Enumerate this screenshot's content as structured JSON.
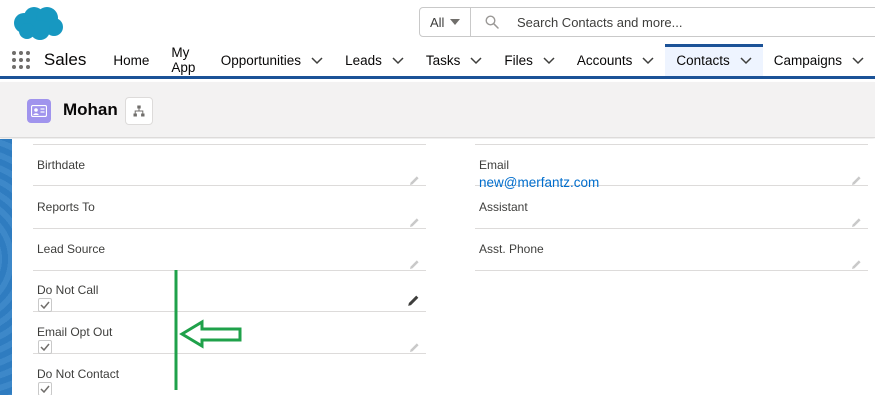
{
  "header": {
    "search": {
      "scope_label": "All",
      "placeholder": "Search Contacts and more..."
    }
  },
  "nav": {
    "app_name": "Sales",
    "items": [
      {
        "label": "Home",
        "has_menu": false,
        "active": false
      },
      {
        "label": "My App",
        "has_menu": false,
        "active": false
      },
      {
        "label": "Opportunities",
        "has_menu": true,
        "active": false
      },
      {
        "label": "Leads",
        "has_menu": true,
        "active": false
      },
      {
        "label": "Tasks",
        "has_menu": true,
        "active": false
      },
      {
        "label": "Files",
        "has_menu": true,
        "active": false
      },
      {
        "label": "Accounts",
        "has_menu": true,
        "active": false
      },
      {
        "label": "Contacts",
        "has_menu": true,
        "active": true
      },
      {
        "label": "Campaigns",
        "has_menu": true,
        "active": false
      }
    ]
  },
  "record": {
    "name": "Mohan"
  },
  "fields": {
    "birthdate": {
      "label": "Birthdate",
      "value": ""
    },
    "reports_to": {
      "label": "Reports To",
      "value": ""
    },
    "lead_source": {
      "label": "Lead Source",
      "value": ""
    },
    "do_not_call": {
      "label": "Do Not Call",
      "checked": true
    },
    "email_opt_out": {
      "label": "Email Opt Out",
      "checked": true
    },
    "do_not_contact": {
      "label": "Do Not Contact",
      "checked": true
    },
    "email": {
      "label": "Email",
      "value": "new@merfantz.com"
    },
    "assistant": {
      "label": "Assistant",
      "value": ""
    },
    "asst_phone": {
      "label": "Asst. Phone",
      "value": ""
    }
  },
  "colors": {
    "brand": "#1b5297",
    "link": "#006dcc",
    "contact_icon": "#a094ed",
    "annotation": "#1fa14a"
  }
}
